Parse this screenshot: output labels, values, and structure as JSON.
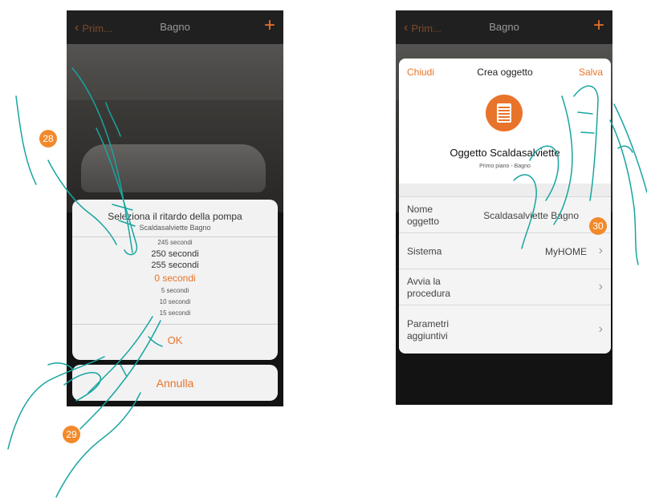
{
  "left_screen": {
    "nav_back": "Prim...",
    "nav_title": "Bagno",
    "nav_add": "+",
    "picker_title": "Seleziona il ritardo della pompa",
    "picker_subtitle": "Scaldasalviette Bagno",
    "options": [
      "245 secondi",
      "250 secondi",
      "255 secondi",
      "0 secondi",
      "5 secondi",
      "10 secondi",
      "15 secondi"
    ],
    "selected_option": "0 secondi",
    "ok_label": "OK",
    "cancel_label": "Annulla"
  },
  "right_screen": {
    "nav_back": "Prim...",
    "nav_title": "Bagno",
    "nav_add": "+",
    "close_label": "Chiudi",
    "modal_title": "Crea oggetto",
    "save_label": "Salva",
    "object_name": "Oggetto Scaldasalviette",
    "object_location": "Primo piano - Bagno",
    "rows": [
      {
        "label": "Nome oggetto",
        "value": "Scaldasalviette Bagno"
      },
      {
        "label": "Sistema",
        "value": "MyHOME"
      },
      {
        "label": "Avvia la procedura",
        "value": ""
      },
      {
        "label": "Parametri aggiuntivi",
        "value": ""
      }
    ]
  },
  "steps": {
    "step_28": "28",
    "step_29": "29",
    "step_30": "30"
  },
  "colors": {
    "accent": "#e8732a",
    "badge": "#f28a2b",
    "hand_outline": "#18a5a0"
  }
}
